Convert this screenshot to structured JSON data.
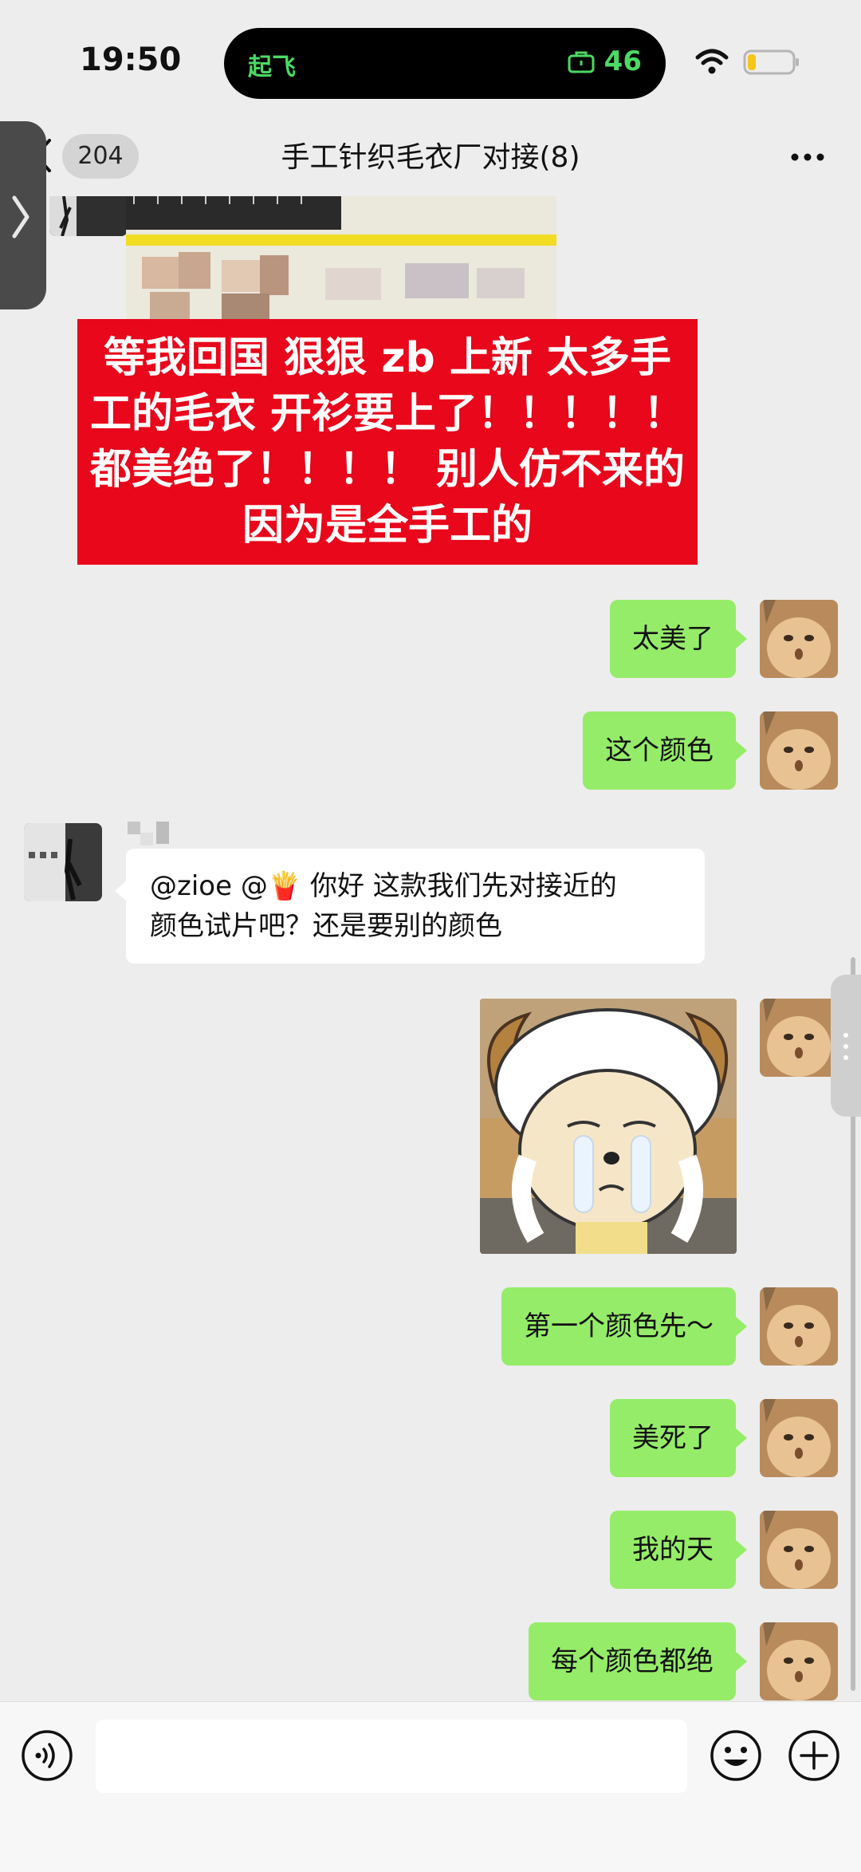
{
  "status_bar": {
    "time": "19:50",
    "island_left_text": "起飞",
    "island_right_value": "46",
    "island_icon": "briefcase-icon",
    "accent_color": "#4cd964"
  },
  "nav": {
    "unread_count": "204",
    "title": "手工针织毛衣厂对接(8)"
  },
  "messages": {
    "promo_lines": [
      "等我回国 狠狠 zb 上新 太多手",
      "工的毛衣 开衫要上了！！！！！",
      "都美绝了！！！！ 别人仿不来的",
      "因为是全手工的"
    ],
    "m1": "太美了",
    "m2": "这个颜色",
    "left_line1": "@zioe @🍟  你好 这款我们先对接近的",
    "left_line2": "颜色试片吧？还是要别的颜色",
    "m3": "第一个颜色先～",
    "m4": "美死了",
    "m5": "我的天",
    "m6": "每个颜色都绝"
  },
  "colors": {
    "bubble_green": "#95ec69",
    "promo_red": "#e8071b",
    "background": "#ededed"
  },
  "input": {
    "value": "",
    "placeholder": ""
  }
}
